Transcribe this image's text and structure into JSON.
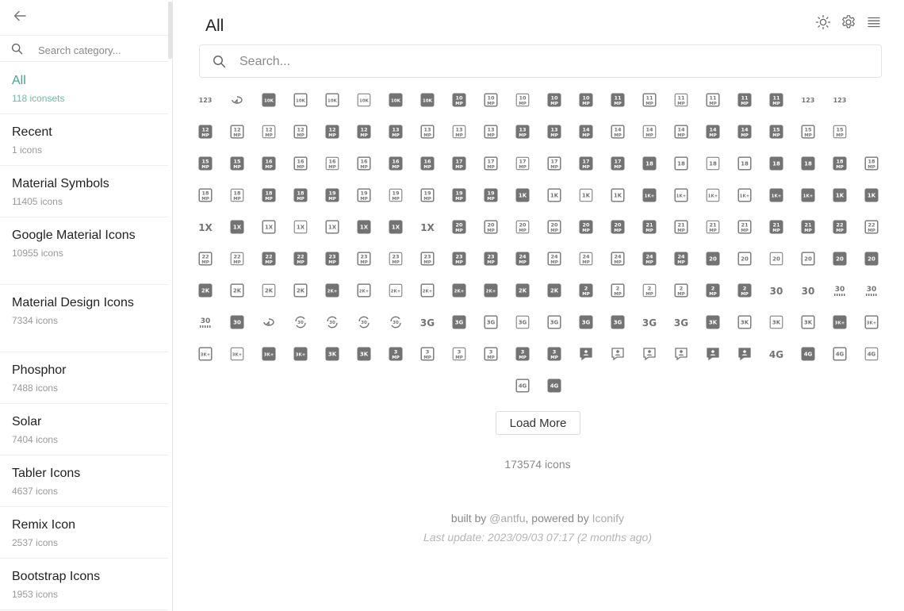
{
  "sidebar": {
    "search_placeholder": "Search category...",
    "categories": [
      {
        "name": "All",
        "count": "118 iconsets",
        "active": true
      },
      {
        "name": "Recent",
        "count": "1 icons"
      },
      {
        "name": "Material Symbols",
        "count": "11405 icons"
      },
      {
        "name": "Google Material Icons",
        "count": "10955 icons"
      },
      {
        "name": "Material Design Icons",
        "count": "7334 icons"
      },
      {
        "name": "Phosphor",
        "count": "7488 icons"
      },
      {
        "name": "Solar",
        "count": "7404 icons"
      },
      {
        "name": "Tabler Icons",
        "count": "4637 icons"
      },
      {
        "name": "Remix Icon",
        "count": "2537 icons"
      },
      {
        "name": "Bootstrap Icons",
        "count": "1953 icons"
      }
    ]
  },
  "main": {
    "title": "All",
    "search_placeholder": "Search...",
    "load_more_label": "Load More",
    "icon_count": "173574 icons",
    "credits": {
      "built_by": "built by",
      "author": "@antfu",
      "powered_by": ", powered by",
      "provider": "Iconify"
    },
    "last_update": "Last update: 2023/09/03 07:17 (2 months ago)"
  },
  "colors": {
    "accent": "#3fa88a",
    "icon": "#737373"
  },
  "icon_rows": [
    [
      "123",
      "arrows-circle",
      "10k-box",
      "10k-box-o",
      "10k-o",
      "10k-thin",
      "10k-box",
      "10k-box",
      "10mp-box",
      "10mp-o",
      "10mp-thin",
      "10mp-box",
      "10mp-box",
      "11mp-box",
      "11mp-o",
      "11mp-thin",
      "11mp-o",
      "11mp-box",
      "11mp-box",
      "123",
      "123"
    ],
    [
      "12mp-box",
      "12mp-o",
      "12mp-thin",
      "12mp-o",
      "12mp-box",
      "12mp-box",
      "13mp-box",
      "13mp-o",
      "13mp-thin",
      "13mp-o",
      "13mp-box",
      "13mp-box",
      "14mp-box",
      "14mp-o",
      "14mp-thin",
      "14mp-o",
      "14mp-box",
      "14mp-box",
      "15mp-box",
      "15mp-o",
      "15mp-thin"
    ],
    [
      "15mp-box",
      "15mp-box",
      "16mp-box",
      "16mp-o",
      "16mp-thin",
      "16mp-o",
      "16mp-box",
      "16mp-box",
      "17mp-box",
      "17mp-o",
      "17mp-thin",
      "17mp-o",
      "17mp-box",
      "17mp-box",
      "18-box",
      "18-o",
      "18-thin",
      "18-o",
      "18-box",
      "18-box",
      "18mp-box",
      "18mp-o"
    ],
    [
      "18mp-o",
      "18mp-thin",
      "18mp-box",
      "18mp-box",
      "19mp-box",
      "19mp-o",
      "19mp-thin",
      "19mp-o",
      "19mp-box",
      "19mp-box",
      "1k-box",
      "1k-o",
      "1k-thin",
      "1k-o",
      "1k-plus-box",
      "1k-plus-o",
      "1k-plus-thin",
      "1k-plus-o",
      "1k-plus-box",
      "1k-plus-box",
      "1k-box",
      "1k-box"
    ],
    [
      "1x",
      "1x-box",
      "1x-o",
      "1x-thin",
      "1x-o",
      "1x-box",
      "1x-box",
      "1x",
      "20mp-box",
      "20mp-o",
      "20mp-thin",
      "20mp-o",
      "20mp-box",
      "20mp-box",
      "21mp-box",
      "21mp-o",
      "21mp-thin",
      "21mp-o",
      "21mp-box",
      "21mp-box",
      "22mp-box",
      "22mp-o"
    ],
    [
      "22mp-o",
      "22mp-thin",
      "22mp-box",
      "22mp-box",
      "23mp-box",
      "23mp-o",
      "23mp-thin",
      "23mp-o",
      "23mp-box",
      "23mp-box",
      "24mp-box",
      "24mp-o",
      "24mp-thin",
      "24mp-o",
      "24mp-box",
      "24mp-box",
      "20-box",
      "20-o",
      "20-thin",
      "20-o",
      "20-box",
      "20-box"
    ],
    [
      "2k-box",
      "2k-o",
      "2k-thin",
      "2k-o",
      "2k-plus-box",
      "2k-plus-o",
      "2k-plus-thin",
      "2k-plus-o",
      "2k-plus-box",
      "2k-plus-box",
      "2k-box",
      "2k-box",
      "2mp-box",
      "2mp-o",
      "2mp-thin",
      "2mp-o",
      "2mp-box",
      "2mp-box",
      "30",
      "30",
      "30-bar",
      "30-bar"
    ],
    [
      "30-bar",
      "30-box",
      "arrows-circle",
      "30-rotate",
      "30-rotate",
      "30-rotate",
      "30-rotate",
      "3g",
      "3g-box",
      "3g-o",
      "3g-thin",
      "3g-o",
      "3g-box",
      "3g-box",
      "3g",
      "3g",
      "3k-box",
      "3k-o",
      "3k-thin",
      "3k-o",
      "3k-plus-box",
      "3k-plus-o"
    ],
    [
      "3k-plus-o",
      "3k-plus-thin",
      "3k-plus-box",
      "3k-plus-box",
      "3k-box",
      "3k-box",
      "3mp-box",
      "3mp-o",
      "3mp-thin",
      "3mp-o",
      "3mp-box",
      "3mp-box",
      "account-box",
      "account-o",
      "account-thin",
      "account-o",
      "account-box",
      "account-box",
      "4g",
      "4g-box",
      "4g-o",
      "4g-thin"
    ],
    [
      "4g-o",
      "4g-box"
    ]
  ]
}
